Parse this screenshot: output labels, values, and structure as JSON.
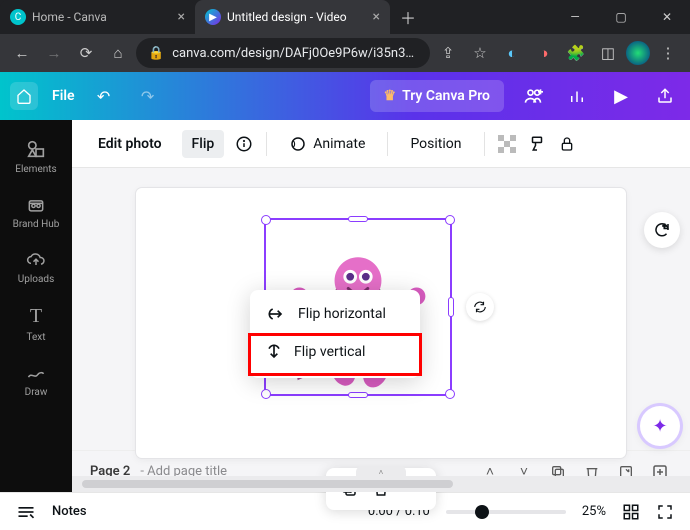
{
  "browser": {
    "tabs": [
      {
        "title": "Home - Canva",
        "active": false
      },
      {
        "title": "Untitled design - Video",
        "active": true
      }
    ],
    "url_display": "canva.com/design/DAFj0Oe9P6w/i35n3…"
  },
  "canva_top": {
    "file_label": "File",
    "try_pro_label": "Try Canva Pro"
  },
  "leftnav": {
    "elements": "Elements",
    "brandhub": "Brand Hub",
    "uploads": "Uploads",
    "text": "Text",
    "draw": "Draw"
  },
  "toolbar": {
    "edit_photo": "Edit photo",
    "flip": "Flip",
    "animate": "Animate",
    "position": "Position"
  },
  "flip_menu": {
    "horizontal": "Flip horizontal",
    "vertical": "Flip vertical"
  },
  "page_strip": {
    "page_label": "Page 2",
    "title_placeholder": "Add page title"
  },
  "bottom": {
    "notes": "Notes",
    "time": "0:00 / 0:10",
    "zoom": "25%"
  }
}
